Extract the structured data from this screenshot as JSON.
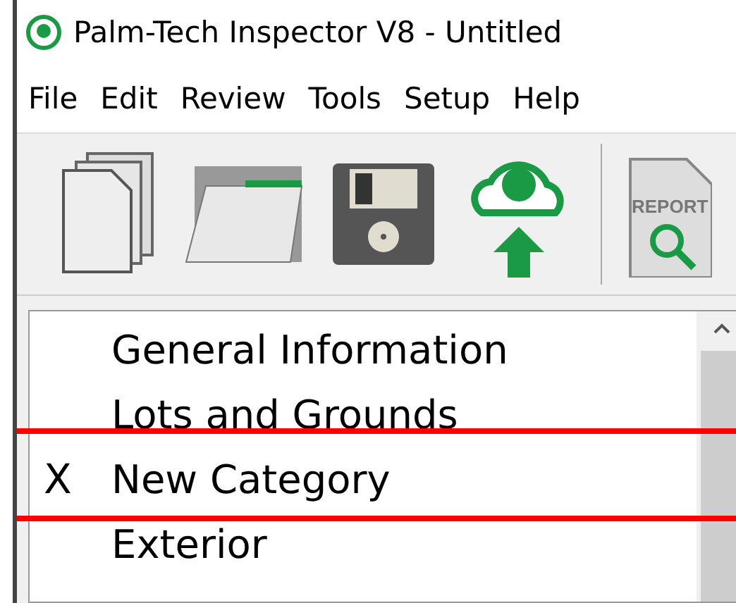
{
  "window": {
    "title": "Palm-Tech Inspector V8 - Untitled"
  },
  "menu": [
    "File",
    "Edit",
    "Review",
    "Tools",
    "Setup",
    "Help"
  ],
  "toolbar": [
    {
      "kind": "new"
    },
    {
      "kind": "open"
    },
    {
      "kind": "save"
    },
    {
      "kind": "upload"
    },
    {
      "kind": "separator"
    },
    {
      "kind": "report",
      "label": "REPORT"
    }
  ],
  "categories": [
    {
      "name": "General Information"
    },
    {
      "name": "Lots and Grounds"
    },
    {
      "name": "New Category",
      "marker": "X",
      "highlighted": true
    },
    {
      "name": "Exterior"
    }
  ]
}
